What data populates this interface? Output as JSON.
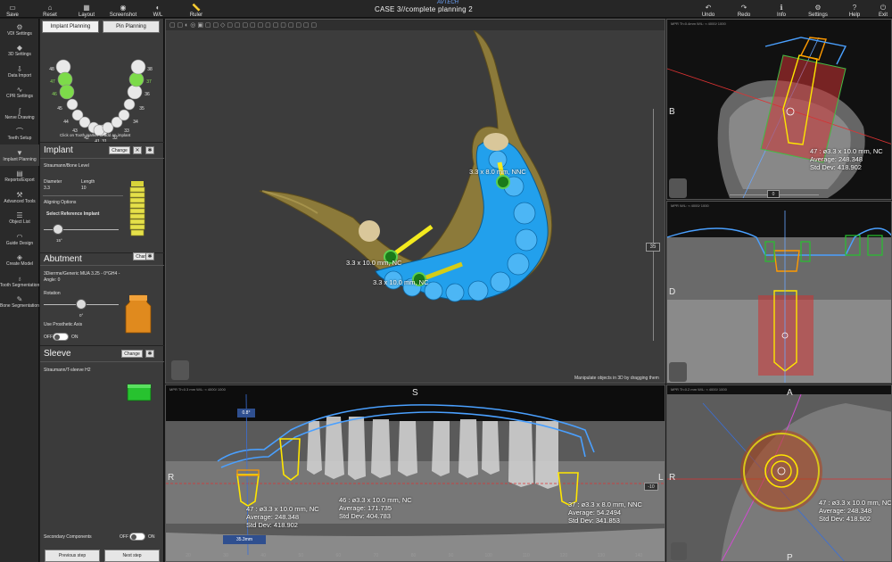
{
  "topbar": {
    "title": "CASE 3//complete planning 2",
    "logo": "AVTECH",
    "left_buttons": [
      {
        "label": "Save",
        "icon": "save-icon",
        "glyph": "▭"
      },
      {
        "label": "Reset",
        "icon": "reset-icon",
        "glyph": "⌂"
      },
      {
        "label": "Layout",
        "icon": "layout-icon",
        "glyph": "▦"
      },
      {
        "label": "Screenshot",
        "icon": "camera-icon",
        "glyph": "◉"
      },
      {
        "label": "W/L",
        "icon": "window-level-icon",
        "glyph": "◐"
      },
      {
        "label": "Ruler",
        "icon": "ruler-icon",
        "glyph": "📏"
      }
    ],
    "right_buttons": [
      {
        "label": "Undo",
        "icon": "undo-icon",
        "glyph": "↶"
      },
      {
        "label": "Redo",
        "icon": "redo-icon",
        "glyph": "↷"
      },
      {
        "label": "Info",
        "icon": "info-icon",
        "glyph": "ℹ"
      },
      {
        "label": "Settings",
        "icon": "gear-icon",
        "glyph": "⚙"
      },
      {
        "label": "Help",
        "icon": "help-icon",
        "glyph": "?"
      },
      {
        "label": "Exit",
        "icon": "exit-icon",
        "glyph": "⏻"
      }
    ]
  },
  "nav": [
    {
      "label": "VDI Settings",
      "icon": "vdi-icon",
      "glyph": "⚙"
    },
    {
      "label": "3D Settings",
      "icon": "3d-settings-icon",
      "glyph": "◆"
    },
    {
      "label": "Data Import",
      "icon": "import-icon",
      "glyph": "⇩"
    },
    {
      "label": "CPR Settings",
      "icon": "cpr-icon",
      "glyph": "∿"
    },
    {
      "label": "Nerve Drawing",
      "icon": "nerve-icon",
      "glyph": "∫"
    },
    {
      "label": "Teeth Setup",
      "icon": "teeth-icon",
      "glyph": "⌒"
    },
    {
      "label": "Implant Planning",
      "icon": "implant-icon",
      "glyph": "▼"
    },
    {
      "label": "Reports/Export",
      "icon": "report-icon",
      "glyph": "▤"
    },
    {
      "label": "Advanced Tools",
      "icon": "tools-icon",
      "glyph": "⚒"
    },
    {
      "label": "Object List",
      "icon": "list-icon",
      "glyph": "☰"
    },
    {
      "label": "Guide Design",
      "icon": "guide-icon",
      "glyph": "◠"
    },
    {
      "label": "Create Model",
      "icon": "model-icon",
      "glyph": "◈"
    },
    {
      "label": "Tooth Segmentation",
      "icon": "tooth-seg-icon",
      "glyph": "♁"
    },
    {
      "label": "Bone Segmentation",
      "icon": "bone-seg-icon",
      "glyph": "✎"
    }
  ],
  "panel": {
    "tabs": [
      "Implant Planning",
      "Pin Planning"
    ],
    "tooth_numbers": [
      "48",
      "47",
      "46",
      "45",
      "44",
      "43",
      "42",
      "41",
      "31",
      "32",
      "33",
      "34",
      "35",
      "36",
      "37",
      "38"
    ],
    "tooth_hint": "Click on Tooth marker to add an implant",
    "implant": {
      "title": "Implant",
      "change": "Change",
      "brand": "Straumann/Bone Level",
      "diameter_label": "Diameter",
      "diameter": "3.3",
      "length_label": "Length",
      "length": "10",
      "aligning": "Aligning Options",
      "select_ref": "Select Reference Implant",
      "angle": "15°"
    },
    "abutment": {
      "title": "Abutment",
      "change": "Change",
      "name": "3Dierrme/Generic MUA 3.25 - 0°GH4 - Angle: 0",
      "rotation": "Rotation",
      "rotation_val": "0°",
      "use_axis": "Use Prosthetic Axis",
      "off": "OFF",
      "on": "ON"
    },
    "sleeve": {
      "title": "Sleeve",
      "change": "Change",
      "name": "Straumann/T-sleeve H2"
    },
    "secondary": "Secondary Components",
    "sec_off": "OFF",
    "sec_on": "ON",
    "prev": "Previous step",
    "next": "Next step"
  },
  "view3d": {
    "labels": [
      "3.3 x 8.0 mm, NNC",
      "3.3 x 10.0 mm, NC",
      "3.3 x 10.0 mm, NC"
    ],
    "slider_value": "35",
    "hint": "Manipulate objects in 3D by dragging them"
  },
  "panoramic": {
    "header": "MPR   Th:0.3 mm   W/L: ≈ 4000/ 1000",
    "top_label": "S",
    "left_label": "R",
    "right_label": "L",
    "angle_tag": "0.8°",
    "ruler_tag": "35.3mm",
    "slider_value": "-10",
    "ticks": [
      "20",
      "30",
      "40",
      "50",
      "60",
      "70",
      "80",
      "90",
      "100",
      "110",
      "120",
      "130",
      "140"
    ],
    "meas": [
      {
        "lines": [
          "47 : ø3.3 x 10.0 mm, NC",
          "Average: 248.348",
          "Std Dev: 418.902"
        ]
      },
      {
        "lines": [
          "46 : ø3.3 x 10.0 mm, NC",
          "Average: 171.735",
          "Std Dev: 404.783"
        ]
      },
      {
        "lines": [
          "37 : ø3.3 x 8.0 mm, NNC",
          "Average: 54.2494",
          "Std Dev: 341.853"
        ]
      }
    ]
  },
  "right_views": {
    "top": {
      "header": "MPR   Th:0.4mm   W/L: ≈ 4000/ 1000",
      "label": "B",
      "slider": "0",
      "meas": [
        "47 : ø3.3 x 10.0 mm, NC",
        "Average: 248.348",
        "Std Dev: 418.902"
      ]
    },
    "mid": {
      "header": "MPR   W/L: ≈ 4000/ 1000",
      "label": "D"
    },
    "bot": {
      "header": "MPR   Th:0.2 mm   W/L: ≈ 4000/ 1000",
      "top_label": "A",
      "left_label": "R",
      "bottom_label": "P",
      "meas": [
        "47 : ø3.3 x 10.0 mm, NC",
        "Average: 248.348",
        "Std Dev: 418.902"
      ]
    }
  }
}
